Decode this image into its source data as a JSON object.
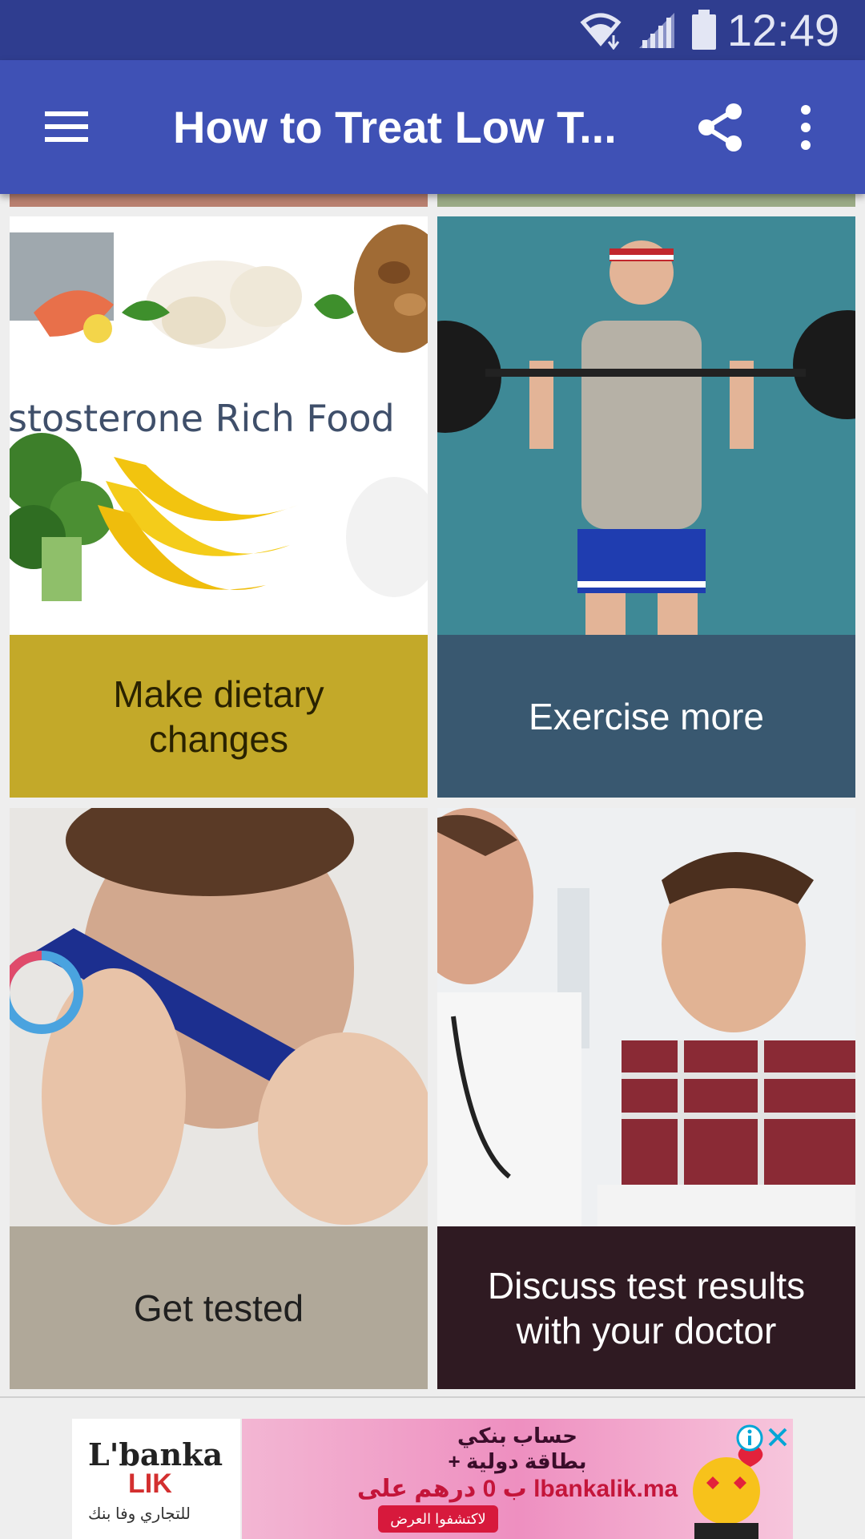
{
  "status_bar": {
    "time": "12:49",
    "icons": [
      "wifi-icon",
      "signal-icon",
      "battery-icon"
    ]
  },
  "app_bar": {
    "title": "How to Treat Low T...",
    "icons": [
      "menu-icon",
      "share-icon",
      "more-vert-icon"
    ]
  },
  "cards": [
    {
      "label": "Make dietary changes",
      "image_text": "stosterone Rich Food",
      "label_bg": "#c3a929",
      "label_color": "#2a2200"
    },
    {
      "label": "Exercise more",
      "label_bg": "#395870",
      "label_color": "#ffffff"
    },
    {
      "label": "Get tested",
      "label_bg": "#b0a899",
      "label_color": "#1f1f1f"
    },
    {
      "label": "Discuss test results with your doctor",
      "label_bg": "#2f1a22",
      "label_color": "#ffffff"
    }
  ],
  "ad": {
    "brand_main": "L'banka",
    "brand_sub": "LIK",
    "brand_tagline": "للتجاري وفا بنك",
    "line1": "حساب بنكي",
    "line2": "+ بطاقة دولية",
    "line3": "ب 0 درهم على lbankalik.ma",
    "cta": "لاكتشفوا العرض",
    "icons": [
      "ad-info-icon",
      "ad-close-icon"
    ]
  },
  "colors": {
    "status_bar": "#2f3d8f",
    "app_bar": "#3f51b5",
    "background": "#eeeeee"
  }
}
